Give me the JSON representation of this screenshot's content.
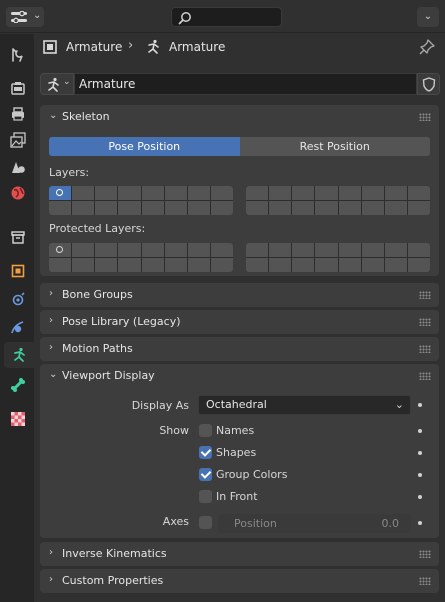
{
  "header": {
    "editor_icon": "properties-editor-icon",
    "search_icon": "search-icon",
    "dropdown_icon": "chevron-down-icon"
  },
  "tabs": [
    {
      "name": "tool",
      "icon": "wrench-screwdriver-icon",
      "color": "#c8c8c8"
    },
    {
      "name": "render",
      "icon": "camera-back-icon",
      "color": "#c8c8c8"
    },
    {
      "name": "output",
      "icon": "printer-icon",
      "color": "#c8c8c8"
    },
    {
      "name": "view-layer",
      "icon": "image-stack-icon",
      "color": "#c8c8c8"
    },
    {
      "name": "scene",
      "icon": "scene-cone-sphere-icon",
      "color": "#c8c8c8"
    },
    {
      "name": "world",
      "icon": "globe-icon",
      "color": "#e05050"
    },
    {
      "name": "collection",
      "icon": "box-icon",
      "color": "#d8d8d8"
    },
    {
      "name": "object",
      "icon": "object-square-icon",
      "color": "#f0a040"
    },
    {
      "name": "modifier",
      "icon": "wrench-icon",
      "color": "#6a9ae0"
    },
    {
      "name": "physics",
      "icon": "orbit-icon",
      "color": "#6a9ae0"
    },
    {
      "name": "armature-data",
      "icon": "running-figure-icon",
      "color": "#3fd0a0",
      "active": true
    },
    {
      "name": "bone",
      "icon": "bone-icon",
      "color": "#3fd0a0"
    },
    {
      "name": "texture",
      "icon": "checker-icon",
      "color": "#e06070"
    }
  ],
  "context": {
    "object_label": "Armature",
    "data_label": "Armature",
    "separator": "›",
    "pin_icon": "pin-icon"
  },
  "datablock": {
    "name": "Armature",
    "fake_user_icon": "shield-icon"
  },
  "skeleton": {
    "title": "Skeleton",
    "pose_position_label": "Pose Position",
    "rest_position_label": "Rest Position",
    "active_mode": "Pose Position",
    "layers_label": "Layers:",
    "protected_layers_label": "Protected Layers:",
    "active_layer_index": 0,
    "protected_marked_layer_index": 0
  },
  "collapsed_panels": {
    "bone_groups": "Bone Groups",
    "pose_library": "Pose Library (Legacy)",
    "motion_paths": "Motion Paths",
    "inverse_kinematics": "Inverse Kinematics",
    "custom_properties": "Custom Properties"
  },
  "viewport_display": {
    "title": "Viewport Display",
    "display_as_label": "Display As",
    "display_as_value": "Octahedral",
    "show_label": "Show",
    "options": [
      {
        "label": "Names",
        "checked": false
      },
      {
        "label": "Shapes",
        "checked": true
      },
      {
        "label": "Group Colors",
        "checked": true
      },
      {
        "label": "In Front",
        "checked": false
      }
    ],
    "axes_label": "Axes",
    "axes_checked": false,
    "axes_position_label": "Position",
    "axes_position_value": "0.0"
  },
  "colors": {
    "accent_blue": "#4772b3",
    "panel_bg": "#3d3d3d",
    "editor_bg": "#303030"
  }
}
